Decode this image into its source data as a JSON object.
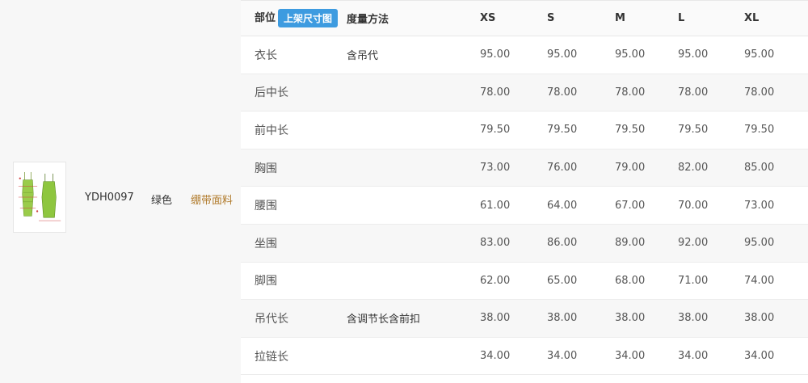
{
  "product": {
    "code": "YDH0097",
    "color": "绿色",
    "fabric": "绷带面料",
    "thumbnail_icon": "dress-thumbnail-icon"
  },
  "table": {
    "header": {
      "part": "部位",
      "size_chart_button": "上架尺寸图",
      "method": "度量方法",
      "sizes": [
        "XS",
        "S",
        "M",
        "L",
        "XL"
      ]
    },
    "rows": [
      {
        "part": "衣长",
        "method": "含吊代",
        "values": [
          "95.00",
          "95.00",
          "95.00",
          "95.00",
          "95.00"
        ]
      },
      {
        "part": "后中长",
        "method": "",
        "values": [
          "78.00",
          "78.00",
          "78.00",
          "78.00",
          "78.00"
        ]
      },
      {
        "part": "前中长",
        "method": "",
        "values": [
          "79.50",
          "79.50",
          "79.50",
          "79.50",
          "79.50"
        ]
      },
      {
        "part": "胸围",
        "method": "",
        "values": [
          "73.00",
          "76.00",
          "79.00",
          "82.00",
          "85.00"
        ]
      },
      {
        "part": "腰围",
        "method": "",
        "values": [
          "61.00",
          "64.00",
          "67.00",
          "70.00",
          "73.00"
        ]
      },
      {
        "part": "坐围",
        "method": "",
        "values": [
          "83.00",
          "86.00",
          "89.00",
          "92.00",
          "95.00"
        ]
      },
      {
        "part": "脚围",
        "method": "",
        "values": [
          "62.00",
          "65.00",
          "68.00",
          "71.00",
          "74.00"
        ]
      },
      {
        "part": "吊代长",
        "method": "含调节长含前扣",
        "values": [
          "38.00",
          "38.00",
          "38.00",
          "38.00",
          "38.00"
        ]
      },
      {
        "part": "拉链长",
        "method": "",
        "values": [
          "34.00",
          "34.00",
          "34.00",
          "34.00",
          "34.00"
        ]
      }
    ]
  },
  "colors": {
    "badge": "#3d9be0",
    "fabric_text": "#b07a2a",
    "dress_green": "#8ec63f"
  }
}
